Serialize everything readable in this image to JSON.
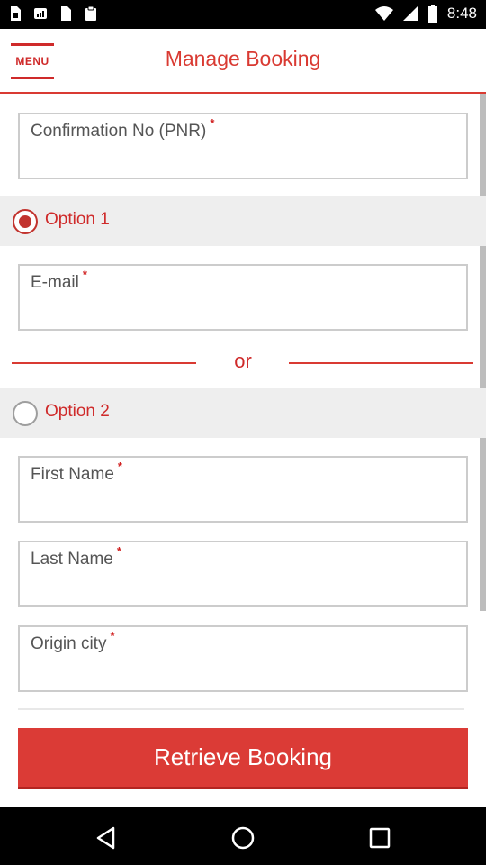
{
  "status_bar": {
    "time": "8:48",
    "left_icons": [
      "sim-icon",
      "signal-strength-icon",
      "storage-icon",
      "clipboard-icon"
    ],
    "right_icons": [
      "wifi-icon",
      "cellular-icon",
      "battery-icon"
    ]
  },
  "header": {
    "menu_label": "MENU",
    "title": "Manage Booking"
  },
  "form": {
    "confirmation": {
      "label": "Confirmation No (PNR)",
      "required_mark": "*",
      "value": ""
    },
    "option1": {
      "label": "Option 1",
      "selected": true
    },
    "email": {
      "label": "E-mail",
      "required_mark": "*",
      "value": ""
    },
    "or_text": "or",
    "option2": {
      "label": "Option 2",
      "selected": false
    },
    "first_name": {
      "label": "First Name",
      "required_mark": "*",
      "value": ""
    },
    "last_name": {
      "label": "Last Name",
      "required_mark": "*",
      "value": ""
    },
    "origin_city": {
      "label": "Origin city",
      "required_mark": "*",
      "value": ""
    }
  },
  "retrieve_button_label": "Retrieve Booking",
  "nav_bar": [
    "back-icon",
    "home-icon",
    "recents-icon"
  ],
  "colors": {
    "accent": "#d93a32",
    "option_bg": "#eeeeee",
    "field_border": "#cccccc"
  }
}
